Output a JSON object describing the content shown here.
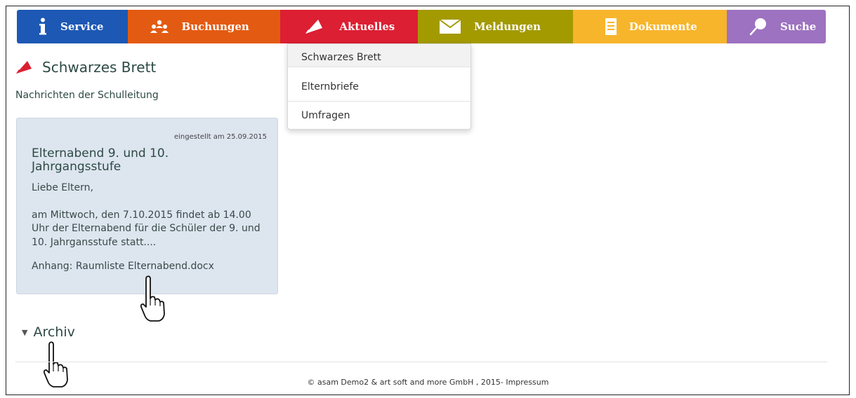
{
  "nav": {
    "items": [
      {
        "label": "Service",
        "color": "#1d58b4",
        "icon": "info-icon"
      },
      {
        "label": "Buchungen",
        "color": "#e35b12",
        "icon": "people-icon"
      },
      {
        "label": "Aktuelles",
        "color": "#dc1f32",
        "icon": "megaphone-icon"
      },
      {
        "label": "Meldungen",
        "color": "#a39a00",
        "icon": "envelope-icon"
      },
      {
        "label": "Dokumente",
        "color": "#f7b52c",
        "icon": "document-icon"
      },
      {
        "label": "Suche",
        "color": "#9d72c0",
        "icon": "search-icon"
      }
    ]
  },
  "dropdown": {
    "items": [
      "Schwarzes Brett",
      "Elternbriefe",
      "Umfragen"
    ]
  },
  "page": {
    "title": "Schwarzes Brett",
    "subtitle": "Nachrichten der Schulleitung"
  },
  "card": {
    "date": "eingestellt am 25.09.2015",
    "title": "Elternabend 9. und 10. Jahrgangsstufe",
    "greeting": "Liebe Eltern,",
    "text": "am Mittwoch, den 7.10.2015 findet ab 14.00 Uhr der Elternabend für die Schüler der 9. und 10. Jahrgansstufe statt....",
    "attachment": "Anhang: Raumliste Elternabend.docx"
  },
  "archive": {
    "label": "Archiv"
  },
  "footer": {
    "text": "© asam Demo2 & art soft and more GmbH , 2015- Impressum"
  }
}
